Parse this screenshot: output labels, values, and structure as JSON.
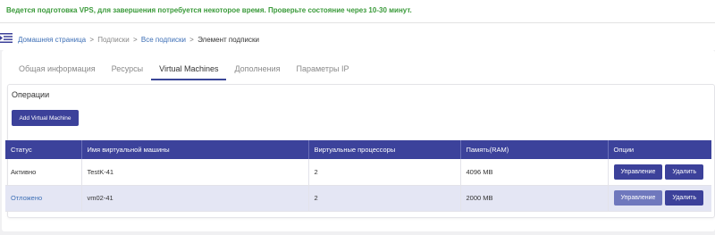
{
  "notice": "Ведется подготовка VPS, для завершения потребуется некоторое время. Проверьте состояние через 10-30 минут.",
  "breadcrumb": {
    "home": "Домашняя страница",
    "subscriptions": "Подписки",
    "all_subscriptions": "Все подписки",
    "current": "Элемент подписки",
    "separator": ">"
  },
  "tabs": [
    {
      "label": "Общая информация",
      "active": false
    },
    {
      "label": "Ресурсы",
      "active": false
    },
    {
      "label": "Virtual Machines",
      "active": true
    },
    {
      "label": "Дополнения",
      "active": false
    },
    {
      "label": "Параметры IP",
      "active": false
    }
  ],
  "operations": {
    "title": "Операции",
    "add_button": "Add Virtual Machine"
  },
  "table": {
    "headers": [
      "Статус",
      "Имя виртуальной машины",
      "Виртуальные процессоры",
      "Память(RAM)",
      "Опции"
    ],
    "rows": [
      {
        "status": "Активно",
        "name": "TestK-41",
        "vcpu": "2",
        "ram": "4096 MB",
        "manage": "Управление",
        "delete": "Удалить"
      },
      {
        "status": "Отложено",
        "name": "vm02-41",
        "vcpu": "2",
        "ram": "2000 MB",
        "manage": "Управление",
        "delete": "Удалить"
      }
    ]
  },
  "colors": {
    "accent": "#3c419a",
    "notice_text": "#3a9a3a",
    "link": "#3d6fb6",
    "alt_row": "#e4e6f4"
  },
  "icons": {
    "menu_toggle": "menu-toggle-icon"
  }
}
